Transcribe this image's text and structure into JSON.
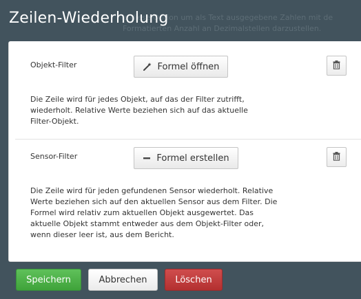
{
  "dialog": {
    "title": "Zeilen-Wiederholung",
    "background_text_line1": "ie diese Option um als Text ausgegebene Zahlen mit de",
    "background_text_line2": "Formatierten Anzahl an Dezimalstellen darzustellen."
  },
  "object_filter": {
    "label": "Objekt-Filter",
    "button_label": "Formel öffnen",
    "button_icon": "magic-wand-icon",
    "description": "Die Zeile wird für jedes Objekt, auf das der Filter zutrifft, wiederholt. Relative Werte beziehen sich auf das aktuelle Filter-Objekt."
  },
  "sensor_filter": {
    "label": "Sensor-Filter",
    "button_label": "Formel erstellen",
    "button_icon": "minus-icon",
    "description": "Die Zeile wird für jeden gefundenen Sensor wiederholt. Relative Werte beziehen sich auf den aktuellen Sensor aus dem Filter. Die Formel wird relativ zum aktuellen Objekt ausgewertet. Das aktuelle Objekt stammt entweder aus dem Objekt-Filter oder, wenn dieser leer ist, aus dem Bericht."
  },
  "footer": {
    "save_label": "Speichern",
    "cancel_label": "Abbrechen",
    "delete_label": "Löschen"
  },
  "colors": {
    "save": "#48ad43",
    "delete": "#c03b3b",
    "title_bar": "#42535d"
  }
}
